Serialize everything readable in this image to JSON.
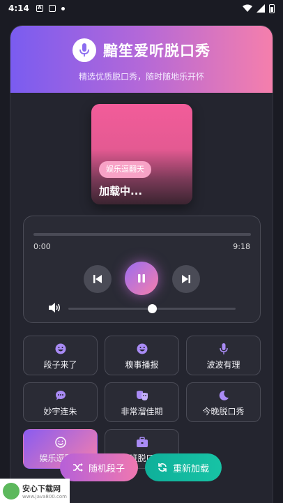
{
  "status_bar": {
    "time": "4:14",
    "notif_a": "A"
  },
  "header": {
    "title": "黯笙爱听脱口秀",
    "subtitle": "精选优质脱口秀，随时随地乐开怀",
    "icon": "mic-icon"
  },
  "cover": {
    "tag": "娱乐逗翻天",
    "status": "加载中..."
  },
  "player": {
    "current_time": "0:00",
    "total_time": "9:18",
    "progress": 0,
    "volume": 0.5
  },
  "categories": [
    {
      "label": "段子来了",
      "icon": "laugh-icon"
    },
    {
      "label": "糗事播报",
      "icon": "grin-wink-icon"
    },
    {
      "label": "波波有理",
      "icon": "mic-icon"
    },
    {
      "label": "妙宇连朱",
      "icon": "comment-dots-icon"
    },
    {
      "label": "非常溜佳期",
      "icon": "masks-icon"
    },
    {
      "label": "今晚脱口秀",
      "icon": "moon-icon"
    },
    {
      "label": "娱乐逗翻天",
      "icon": "smile-icon",
      "active": true
    },
    {
      "label": "上班脱口秀",
      "icon": "briefcase-icon"
    }
  ],
  "actions": {
    "random": "随机段子",
    "reload": "重新加载"
  },
  "watermark": {
    "title": "安心下载网",
    "sub": "www.java800.com"
  },
  "colors": {
    "accent_purple": "#8b6cf0",
    "accent_pink": "#f57fac",
    "accent_teal": "#17c3a5",
    "bg": "#1a1b23"
  }
}
